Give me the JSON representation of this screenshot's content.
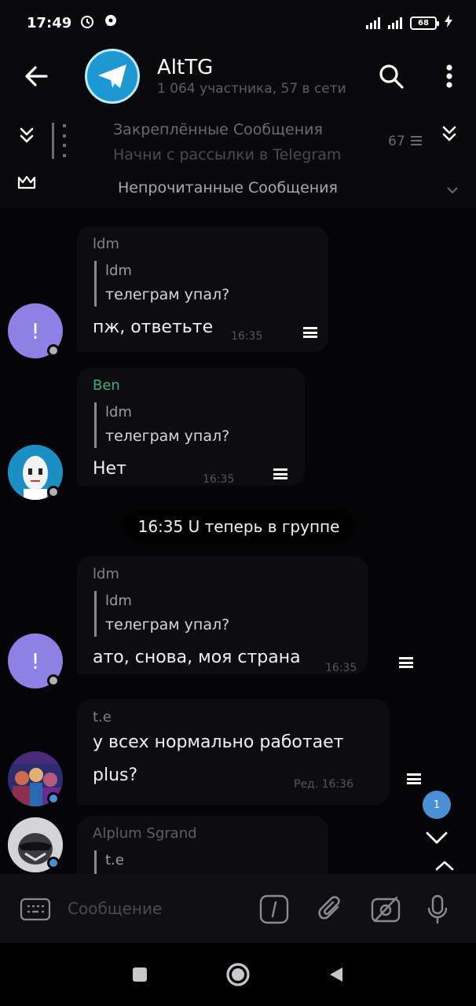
{
  "status_bar": {
    "time": "17:49",
    "battery": "68"
  },
  "header": {
    "title": "AltTG",
    "subtitle": "1 064 участника, 57 в сети"
  },
  "pinned": {
    "title": "Закреплённые Сообщения",
    "text": "Начни с рассылки в Telegram",
    "count": "67"
  },
  "unread_banner": "Непрочитанные Сообщения",
  "messages": [
    {
      "sender": "ldm",
      "sender_color": "#7f7f87",
      "reply_name": "ldm",
      "reply_text": "телеграм упал?",
      "text": "пж, ответьте",
      "time": "16:35",
      "avatar_letter": "!",
      "avatar_color": "#8f80e6"
    },
    {
      "sender": "Ben",
      "sender_color": "#3fae72",
      "reply_name": "ldm",
      "reply_text": "телеграм упал?",
      "text": "Нет",
      "time": "16:35"
    },
    {
      "sender": "ldm",
      "sender_color": "#7f7f87",
      "reply_name": "ldm",
      "reply_text": "телеграм упал?",
      "text": "ато, снова, моя страна",
      "time": "16:35",
      "avatar_letter": "!",
      "avatar_color": "#8f80e6"
    },
    {
      "sender": "t.e",
      "sender_color": "#7f7f87",
      "text_line1": "у всех нормально работает",
      "text_line2": "plus?",
      "time": "Ред. 16:36"
    },
    {
      "sender": "Alplum Sgrand",
      "sender_color": "#5e5e66",
      "reply_name": "t.e"
    }
  ],
  "service_message": "16:35 U теперь в группе",
  "unread_count": "1",
  "input": {
    "placeholder": "Сообщение"
  },
  "colors": {
    "accent": "#1d98d2",
    "badge": "#4a90d9"
  }
}
